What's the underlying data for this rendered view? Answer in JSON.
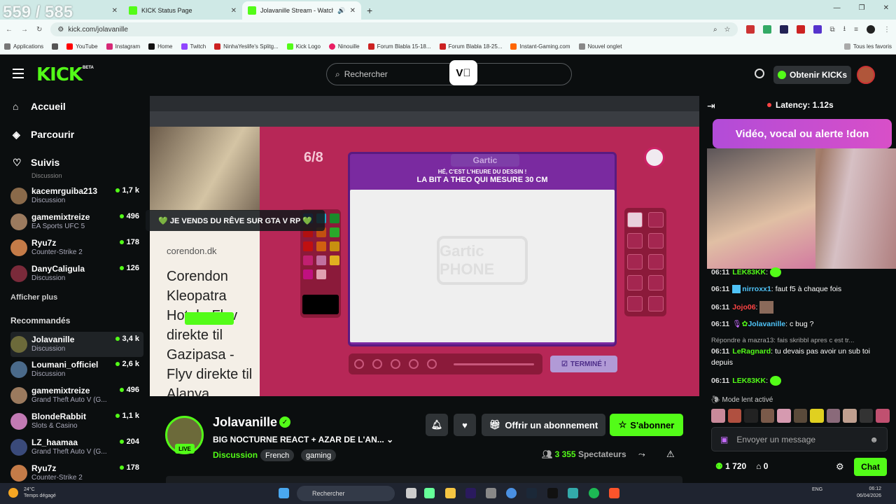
{
  "browser": {
    "tab_counter": "559 / 585",
    "tabs": [
      {
        "title": "",
        "color": "#53fc18"
      },
      {
        "title": "KICK Status Page",
        "color": "#53fc18"
      },
      {
        "title": "Jolavanille Stream - Watch",
        "color": "#53fc18"
      }
    ],
    "url": "kick.com/jolavanille",
    "bookmarks": [
      {
        "label": "Applications",
        "color": "#777"
      },
      {
        "label": "",
        "color": "#555"
      },
      {
        "label": "YouTube",
        "color": "#f00"
      },
      {
        "label": "Instagram",
        "color": "#d62976"
      },
      {
        "label": "Home",
        "color": "#111"
      },
      {
        "label": "Twitch",
        "color": "#9146ff"
      },
      {
        "label": "NinhaYeslife's Splitg...",
        "color": "#c22"
      },
      {
        "label": "Kick Logo",
        "color": "#53fc18"
      },
      {
        "label": "Ninouille",
        "color": "#e91e63"
      },
      {
        "label": "Forum Blabla 15-18...",
        "color": "#c22"
      },
      {
        "label": "Forum Blabla 18-25...",
        "color": "#c22"
      },
      {
        "label": "Instant-Gaming.com",
        "color": "#f60"
      },
      {
        "label": "Nouvel onglet",
        "color": "#888"
      }
    ],
    "all_favorites": "Tous les favoris"
  },
  "header": {
    "logo": "KICK",
    "beta": "BETA",
    "search_placeholder": "Rechercher",
    "get_kicks": "Obtenir KICKs"
  },
  "sidebar": {
    "nav": [
      {
        "label": "Accueil",
        "icon": "home-icon"
      },
      {
        "label": "Parcourir",
        "icon": "compass-icon"
      },
      {
        "label": "Suivis",
        "icon": "heart-icon"
      }
    ],
    "partial_category": "Discussion",
    "followed": [
      {
        "name": "kacemrguiba213",
        "category": "Discussion",
        "viewers": "1,7 k",
        "color": "#8a6a4a"
      },
      {
        "name": "gamemixtreize",
        "category": "EA Sports UFC 5",
        "viewers": "496",
        "color": "#9b7a5e"
      },
      {
        "name": "Ryu7z",
        "category": "Counter-Strike 2",
        "viewers": "178",
        "color": "#c47b48"
      },
      {
        "name": "DanyCaligula",
        "category": "Discussion",
        "viewers": "126",
        "color": "#7a2a3a"
      }
    ],
    "show_more": "Afficher plus",
    "recommended_title": "Recommandés",
    "recommended": [
      {
        "name": "Jolavanille",
        "category": "Discussion",
        "viewers": "3,4 k",
        "color": "#6c6a3a"
      },
      {
        "name": "Loumani_officiel",
        "category": "Discussion",
        "viewers": "2,6 k",
        "color": "#4a6a8a"
      },
      {
        "name": "gamemixtreize",
        "category": "Grand Theft Auto V (G...",
        "viewers": "496",
        "color": "#9b7a5e"
      },
      {
        "name": "BlondeRabbit",
        "category": "Slots & Casino",
        "viewers": "1,1 k",
        "color": "#c27ab4"
      },
      {
        "name": "LZ_haamaa",
        "category": "Grand Theft Auto V (G...",
        "viewers": "204",
        "color": "#3a4a7a"
      },
      {
        "name": "Ryu7z",
        "category": "Counter-Strike 2",
        "viewers": "178",
        "color": "#c47b48"
      }
    ]
  },
  "video": {
    "overlay_message": "💚 JE VENDS DU RÊVE SUR GTA V RP 💚",
    "counter": "6/8",
    "gartic_title": "Gartic",
    "instruction": "HÉ, C'EST L'HEURE DU DESSIN !",
    "prompt": "LA BIT A THEO QUI MESURE 30 CM",
    "watermark": "Gartic PHONE",
    "done_button": "TERMINÉ !",
    "ad_site": "corendon.dk",
    "ad_text": "Corendon Kleopatra Hotel - Flyv direkte til Gazipasa - Flyv direkte til Alanya",
    "palette_colors": [
      "#1f5fc8",
      "#1fa8c8",
      "#1a8a2a",
      "#b01010",
      "#c25010",
      "#2aa82a",
      "#c01010",
      "#d06010",
      "#c89010",
      "#c02070",
      "#c070a0",
      "#e0b020",
      "#c01080",
      "#e0a0b0"
    ]
  },
  "stream": {
    "name": "Jolavanille",
    "live": "LIVE",
    "title": "BIG NOCTURNE REACT + AZAR DE L'AN...",
    "category": "Discussion",
    "tags": [
      "French",
      "gaming"
    ],
    "offer_sub": "Offrir un abonnement",
    "subscribe": "S'abonner",
    "viewers_count": "3 355",
    "viewers_label": "Spectateurs"
  },
  "chat": {
    "latency": "Latency: 1.12s",
    "donation_banner": "Vidéo, vocal ou alerte !don",
    "messages": [
      {
        "time": "06:11",
        "user": "LEK83KK",
        "text": "",
        "color": "#53fc18"
      },
      {
        "time": "06:11",
        "user": "nirroxx1",
        "text": "faut f5 à chaque fois",
        "color": "#4fc3f7"
      },
      {
        "time": "06:11",
        "user": "Jojo06",
        "text": "",
        "color": "#f44"
      },
      {
        "time": "06:11",
        "user": "Jolavanille",
        "text": "c bug ?",
        "color": "#4fc3f7"
      },
      {
        "time": "06:11",
        "user": "LeRagnard",
        "text": "tu devais pas avoir un sub toi depuis",
        "color": "#53fc18"
      },
      {
        "time": "06:11",
        "user": "LEK83KK",
        "text": "",
        "color": "#53fc18"
      }
    ],
    "reply_to": "Répondre à mazra13: fais skribbl apres c est tr...",
    "slow_mode": "Mode lent activé",
    "input_placeholder": "Envoyer un message",
    "kicks_balance": "1 720",
    "points": "0",
    "chat_button": "Chat"
  },
  "taskbar": {
    "temp": "24°C",
    "weather": "Temps dégagé",
    "search": "Rechercher",
    "lang": "ENG",
    "time": "06:12",
    "date": "06/04/2026"
  }
}
